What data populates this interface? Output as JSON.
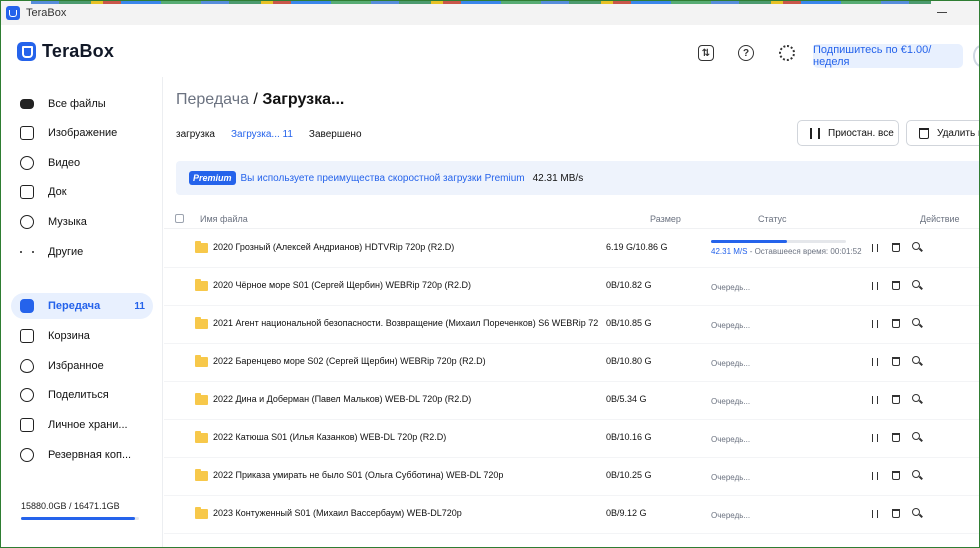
{
  "window": {
    "title": "TeraBox"
  },
  "header": {
    "logo": "TeraBox",
    "icons": [
      "transfer-icon",
      "help-icon",
      "settings-icon"
    ],
    "premium_button": "Подпишитесь по €1.00/неделя"
  },
  "sidebar": {
    "items": [
      {
        "label": "Все файлы",
        "icon": "all-files-icon"
      },
      {
        "label": "Изображение",
        "icon": "image-icon"
      },
      {
        "label": "Видео",
        "icon": "video-icon"
      },
      {
        "label": "Док",
        "icon": "document-icon"
      },
      {
        "label": "Музыка",
        "icon": "music-icon"
      },
      {
        "label": "Другие",
        "icon": "more-dots-icon"
      },
      {
        "label": "Передача",
        "icon": "transfer-icon",
        "count": "11",
        "active": true
      },
      {
        "label": "Корзина",
        "icon": "trash-icon"
      },
      {
        "label": "Избранное",
        "icon": "heart-icon"
      },
      {
        "label": "Поделиться",
        "icon": "share-icon"
      },
      {
        "label": "Личное храни...",
        "icon": "vault-icon"
      },
      {
        "label": "Резервная коп...",
        "icon": "backup-icon"
      }
    ],
    "storage": {
      "text": "15880.0GB / 16471.1GB",
      "used_fraction": 0.964
    }
  },
  "main": {
    "breadcrumb": {
      "parent": "Передача",
      "separator": " / ",
      "current": "Загрузка..."
    },
    "tabs": [
      {
        "label": "загрузка"
      },
      {
        "label": "Загрузка... 11",
        "active": true
      },
      {
        "label": "Завершено"
      }
    ],
    "actions": {
      "pause_all": "Приостан. все",
      "delete_all": "Удалить вс"
    },
    "banner": {
      "badge": "Premium",
      "text": "Вы используете преимущества скоростной загрузки Premium",
      "speed": "42.31 MB/s"
    },
    "columns": {
      "name": "Имя файла",
      "size": "Размер",
      "status": "Статус",
      "action": "Действие"
    },
    "rows": [
      {
        "name": "2020 Грозный (Алексей Андрианов) HDTVRip 720p (R2.D)",
        "size": "6.19 G/10.86 G",
        "progress": 0.56,
        "speed": "42.31 M/S",
        "status": " - Оставшееся время: 00:01:52"
      },
      {
        "name": "2020 Чёрное море S01 (Сергей Щербин) WEBRip 720p (R2.D)",
        "size": "0B/10.82 G",
        "status": "Очередь..."
      },
      {
        "name": "2021 Агент национальной безопасности. Возвращение (Михаил Пореченков) S6 WEBRip 720p",
        "size": "0B/10.85 G",
        "status": "Очередь..."
      },
      {
        "name": "2022 Баренцево море S02 (Сергей Щербин) WEBRip 720p (R2.D)",
        "size": "0B/10.80 G",
        "status": "Очередь..."
      },
      {
        "name": "2022 Дина и Доберман (Павел Мальков) WEB-DL 720p (R2.D)",
        "size": "0B/5.34 G",
        "status": "Очередь..."
      },
      {
        "name": "2022 Катюша S01 (Илья Казанков) WEB-DL 720p (R2.D)",
        "size": "0B/10.16 G",
        "status": "Очередь..."
      },
      {
        "name": "2022 Приказа умирать не было S01 (Ольга Субботина) WEB-DL 720p",
        "size": "0B/10.25 G",
        "status": "Очередь..."
      },
      {
        "name": "2023 Контуженный S01 (Михаил Вассербаум) WEB-DL720p",
        "size": "0B/9.12 G",
        "status": "Очередь..."
      }
    ]
  }
}
